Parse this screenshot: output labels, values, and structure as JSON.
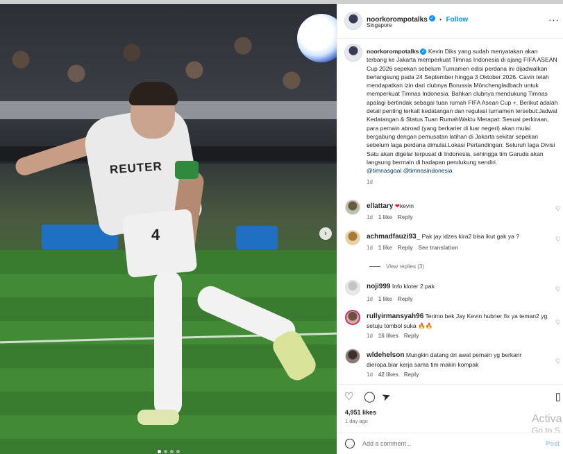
{
  "post": {
    "username": "noorkorompotalks",
    "follow_label": "Follow",
    "location": "Singapore",
    "dot_sep": "•",
    "more": "···"
  },
  "photo": {
    "shirt_text": "REUTER",
    "shirt_number": "4",
    "next_arrow": "›",
    "carousel_dots": 4,
    "active_dot": 0
  },
  "caption": {
    "username": "noorkorompotalks",
    "text": "Kevin Diks yang sudah menyatakan akan terbang ke Jakarta memperkuat Timnas Indonesia di ajang FIFA ASEAN Cup 2026 sepekan sebelum Turnamen edisi perdana ini dijadwalkan berlangsung pada 24 September hingga 3 Oktober 2026. Cavin telah mendapatkan izin dari clubnya Borussia Mönchengladbach untuk memperkuat Timnas Indonesia. Bahkan clubnya mendukung Timnas apalagi bertindak sebagai tuan rumah FIFA Asean Cup +. Berikut adalah detail penting terkait kedatangan dan regulasi turnamen tersebut:Jadwal Kedatangan & Status Tuan RumahWaktu Merapat: Sesuai perkiraan, para pemain abroad (yang berkarier di luar negeri) akan mulai bergabung dengan pemusatan latihan di Jakarta sekitar sepekan sebelum laga perdana dimulai.Lokasi Pertandingan: Seluruh laga Divisi Satu akan digelar terpusat di Indonesia, sehingga tim Garuda akan langsung bermain di hadapan pendukung sendiri.",
    "tag1": "@timnasgoal",
    "tag2": "@timnasindonesia",
    "time": "1d"
  },
  "comments": [
    {
      "username": "ellattary",
      "text": "kevin",
      "time": "1d",
      "likes": "1 like",
      "reply": "Reply",
      "translate": ""
    },
    {
      "username": "achmadfauzi93_",
      "text": "Pak jay idzes kira2 bisa ikut gak ya ?",
      "time": "1d",
      "likes": "1 like",
      "reply": "Reply",
      "translate": "See translation",
      "view_replies": "View replies (3)"
    },
    {
      "username": "noji999",
      "text": "Info kloter 2 pak",
      "time": "1d",
      "likes": "1 like",
      "reply": "Reply",
      "translate": ""
    },
    {
      "username": "rullyirmansyah96",
      "text": "Terimo bek Jay Kevin hubner fix ya teman2 yg setuju tombol suka 🔥🔥",
      "time": "1d",
      "likes": "16 likes",
      "reply": "Reply",
      "translate": ""
    },
    {
      "username": "wldehelson",
      "text": "Mungkin datang dri awal pemain yg berkarir dieropa.biar kerja sama tim makin kompak",
      "time": "1d",
      "likes": "42 likes",
      "reply": "Reply",
      "translate": ""
    }
  ],
  "actions": {
    "like_count": "4,951 likes",
    "posted": "1 day ago",
    "add_comment_placeholder": "Add a comment...",
    "post_label": "Post"
  },
  "watermark": {
    "line1": "Activa",
    "line2": "Go to S"
  },
  "colors": {
    "accent": "#0095f6",
    "text": "#262626",
    "muted": "#737373"
  }
}
